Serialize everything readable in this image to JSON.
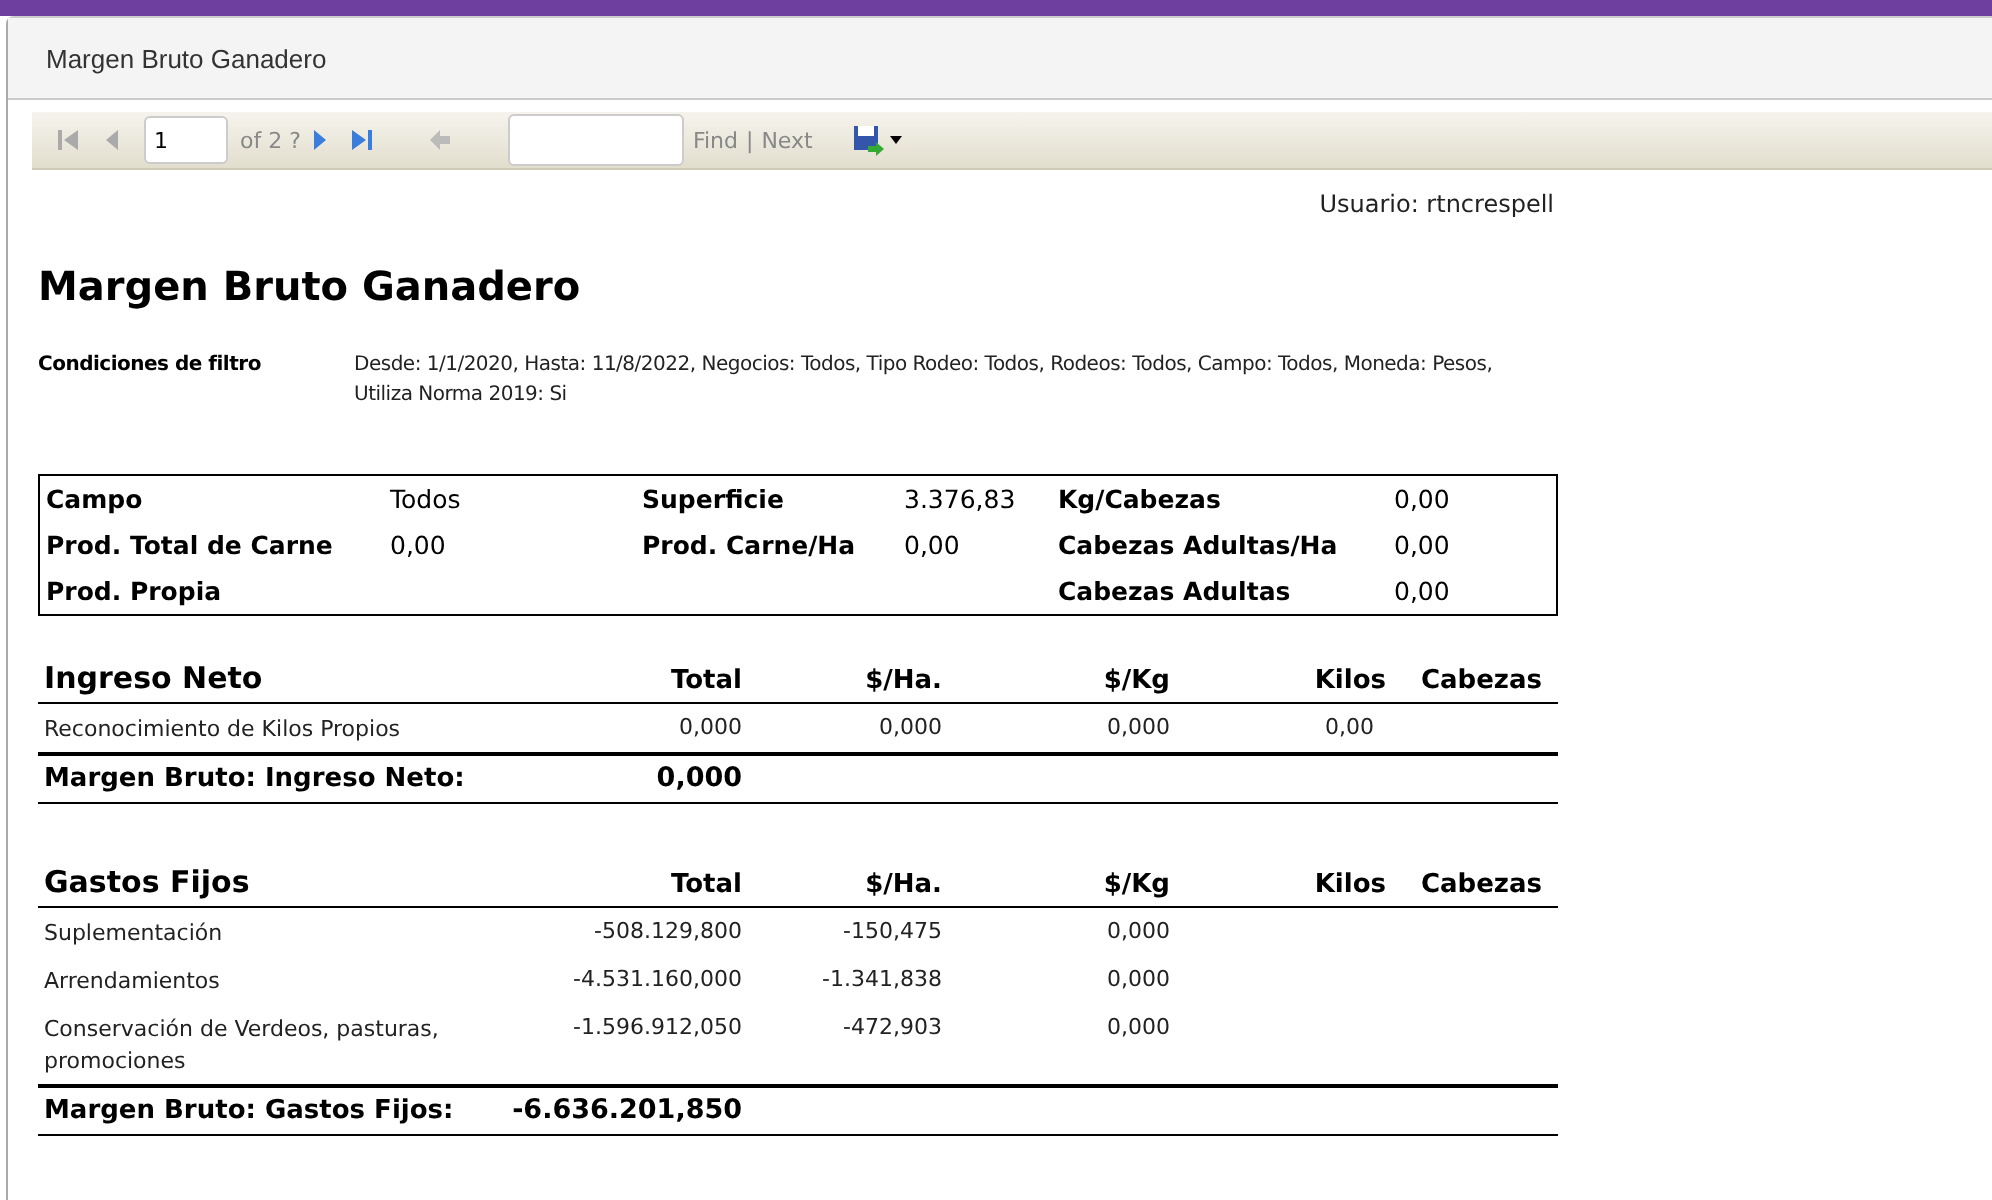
{
  "dialog": {
    "title": "Margen Bruto Ganadero"
  },
  "toolbar": {
    "page": "1",
    "page_count": "of 2 ?",
    "find": "Find",
    "separator": "|",
    "next": "Next"
  },
  "report": {
    "user": "Usuario: rtncrespell",
    "title": "Margen Bruto Ganadero",
    "filter_label": "Condiciones de filtro",
    "filter_text": "Desde: 1/1/2020, Hasta: 11/8/2022, Negocios: Todos, Tipo Rodeo: Todos, Rodeos: Todos, Campo: Todos, Moneda: Pesos, Utiliza Norma 2019: Si",
    "summary_columns": [
      [
        {
          "label": "Campo",
          "value": "Todos"
        },
        {
          "label": "Prod. Total de Carne",
          "value": "0,00"
        },
        {
          "label": "Prod. Propia"
        }
      ],
      [
        {
          "label": "Superficie",
          "value": "3.376,83"
        },
        {
          "label": "Prod. Carne/Ha",
          "value": "0,00"
        }
      ],
      [
        {
          "label": "Kg/Cabezas",
          "value": "0,00"
        },
        {
          "label": "Cabezas Adultas/Ha",
          "value": "0,00"
        },
        {
          "label": "Cabezas Adultas",
          "value": "0,00"
        }
      ]
    ],
    "sections": [
      {
        "columns": [
          "Ingreso Neto",
          "Total",
          "$/Ha.",
          "$/Kg",
          "Kilos",
          "Cabezas"
        ],
        "rows": [
          [
            "Reconocimiento de Kilos Propios",
            "0,000",
            "0,000",
            "0,000",
            "0,00",
            ""
          ]
        ],
        "total_label": "Margen Bruto: Ingreso Neto:",
        "total_value": "0,000"
      },
      {
        "columns": [
          "Gastos Fijos",
          "Total",
          "$/Ha.",
          "$/Kg",
          "Kilos",
          "Cabezas"
        ],
        "rows": [
          [
            "Suplementación",
            "-508.129,800",
            "-150,475",
            "0,000",
            "",
            ""
          ],
          [
            "Arrendamientos",
            "-4.531.160,000",
            "-1.341,838",
            "0,000",
            "",
            ""
          ],
          [
            "Conservación de Verdeos, pasturas, promociones",
            "-1.596.912,050",
            "-472,903",
            "0,000",
            "",
            ""
          ]
        ],
        "total_label": "Margen Bruto: Gastos Fijos:",
        "total_value": "-6.636.201,850"
      }
    ]
  }
}
